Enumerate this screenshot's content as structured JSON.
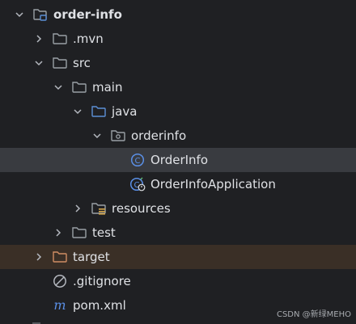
{
  "tree": {
    "items": [
      {
        "label": "order-info",
        "icon": "module-folder-icon",
        "expanded": true
      },
      {
        "label": ".mvn",
        "icon": "folder-icon",
        "expanded": false
      },
      {
        "label": "src",
        "icon": "folder-icon",
        "expanded": true
      },
      {
        "label": "main",
        "icon": "folder-icon",
        "expanded": true
      },
      {
        "label": "java",
        "icon": "source-root-folder-icon",
        "expanded": true
      },
      {
        "label": "orderinfo",
        "icon": "package-icon",
        "expanded": true
      },
      {
        "label": "OrderInfo",
        "icon": "java-class-icon"
      },
      {
        "label": "OrderInfoApplication",
        "icon": "spring-boot-class-icon"
      },
      {
        "label": "resources",
        "icon": "resources-folder-icon",
        "expanded": false
      },
      {
        "label": "test",
        "icon": "folder-icon",
        "expanded": false
      },
      {
        "label": "target",
        "icon": "excluded-folder-icon",
        "expanded": false
      },
      {
        "label": ".gitignore",
        "icon": "ignore-file-icon"
      },
      {
        "label": "pom.xml",
        "icon": "maven-icon"
      }
    ]
  },
  "colors": {
    "background": "#1f2023",
    "selected_row": "#393b40",
    "excluded_row": "#3a2f26",
    "folder": "#9aa0a6",
    "source_root": "#5c8fd6",
    "class_icon": "#5a8fe6",
    "excluded_folder": "#d08d63",
    "maven": "#5a8fe6"
  },
  "watermark": "CSDN @新绿MEHO"
}
